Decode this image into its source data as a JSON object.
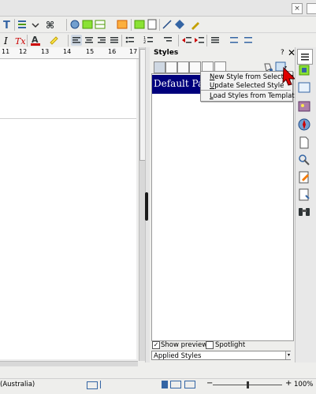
{
  "window": {
    "close_glyph": "×"
  },
  "toolbar": {
    "icons": [
      "text-icon",
      "list-icon",
      "link-icon",
      "spell-icon",
      "style-icon",
      "table-icon",
      "draw-icon",
      "font-color-icon",
      "highlight-icon",
      "align-left-icon",
      "align-center-icon",
      "align-right-icon",
      "justify-icon",
      "bullets-icon",
      "numbering-icon",
      "indent-icon"
    ]
  },
  "ruler": {
    "ticks": [
      "11",
      "12",
      "13",
      "14",
      "15",
      "16",
      "17"
    ]
  },
  "styles_panel": {
    "title": "Styles",
    "menu_glyph": "?",
    "close_glyph": "✕",
    "selected_style": "Default Paragraph Style",
    "dropdown": {
      "items": [
        "New Style from Selection",
        "Update Selected Style",
        "Load Styles from Template"
      ]
    },
    "show_previews_label": "Show previews",
    "show_previews_checked": true,
    "spotlight_label": "Spotlight",
    "spotlight_checked": false,
    "filter_value": "Applied Styles"
  },
  "sidebar": {
    "icons": [
      "menu-icon",
      "gallery-icon",
      "navigator-icon",
      "page-icon",
      "style-brush-icon",
      "manage-changes-icon",
      "design-icon",
      "find-icon"
    ]
  },
  "statusbar": {
    "language": "(Australia)",
    "zoom": "100%"
  }
}
